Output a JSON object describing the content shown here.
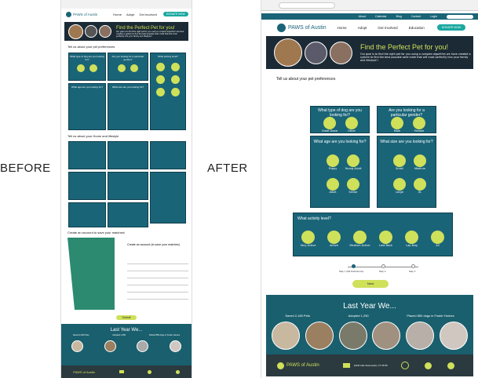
{
  "labels": {
    "before": "BEFORE",
    "after": "AFTER"
  },
  "site": {
    "name": "PAWS of Austin",
    "nav": [
      "Home",
      "Adopt",
      "Get Involved",
      "Education"
    ],
    "topnav": [
      "About",
      "Calendar",
      "Blog",
      "Contact",
      "Login"
    ],
    "cta": "DONATE NOW",
    "search_placeholder": "Search"
  },
  "hero": {
    "title": "Find the Perfect Pet for you!",
    "text": "Our goal is to find the right pet for you using a complex algorithm we have created a system to find the best possible seek mate that will most perfectly into your family and lifestyle!!"
  },
  "section": "Tell us about your pet preferences",
  "cards": {
    "type": {
      "q": "What type of dog are you looking for?",
      "opts": [
        "Great Dane",
        "Other"
      ]
    },
    "gender": {
      "q": "Are you looking for a particular gender?",
      "opts": [
        "Male",
        "Female"
      ]
    },
    "age": {
      "q": "What age are you looking for?",
      "opts": [
        "Puppy",
        "Young Adult",
        "Adult",
        "Senior"
      ]
    },
    "size": {
      "q": "What size are you looking for?",
      "opts": [
        "Small",
        "Medium",
        "Large",
        "XL"
      ]
    },
    "activity": {
      "q": "What activity level?",
      "opts": [
        "Very Active",
        "Active",
        "Medium Active",
        "Laid Back",
        "Lap Dog",
        "All"
      ]
    }
  },
  "steps": [
    "Step 1",
    "Step 2",
    "Step 3"
  ],
  "step_label": "Step 1 (Pet Preferences)",
  "next_label": "Next",
  "footer": {
    "title": "Last Year We...",
    "stats": [
      "Saved 2,180 Pets",
      "Adopted 1,250",
      "Placed 850 dogs in Foster Homes"
    ],
    "address": "12345 Little Texas Austin, TX 78748"
  },
  "before": {
    "section2": "Tell us about your Home and lifestyle",
    "section3": "Create an account to save your matches!",
    "account_title": "Create an account (to save your matches)",
    "submit": "Submit"
  },
  "colors": {
    "teal": "#1a6478",
    "lime": "#cfe05a",
    "dark": "#1b2a35"
  }
}
